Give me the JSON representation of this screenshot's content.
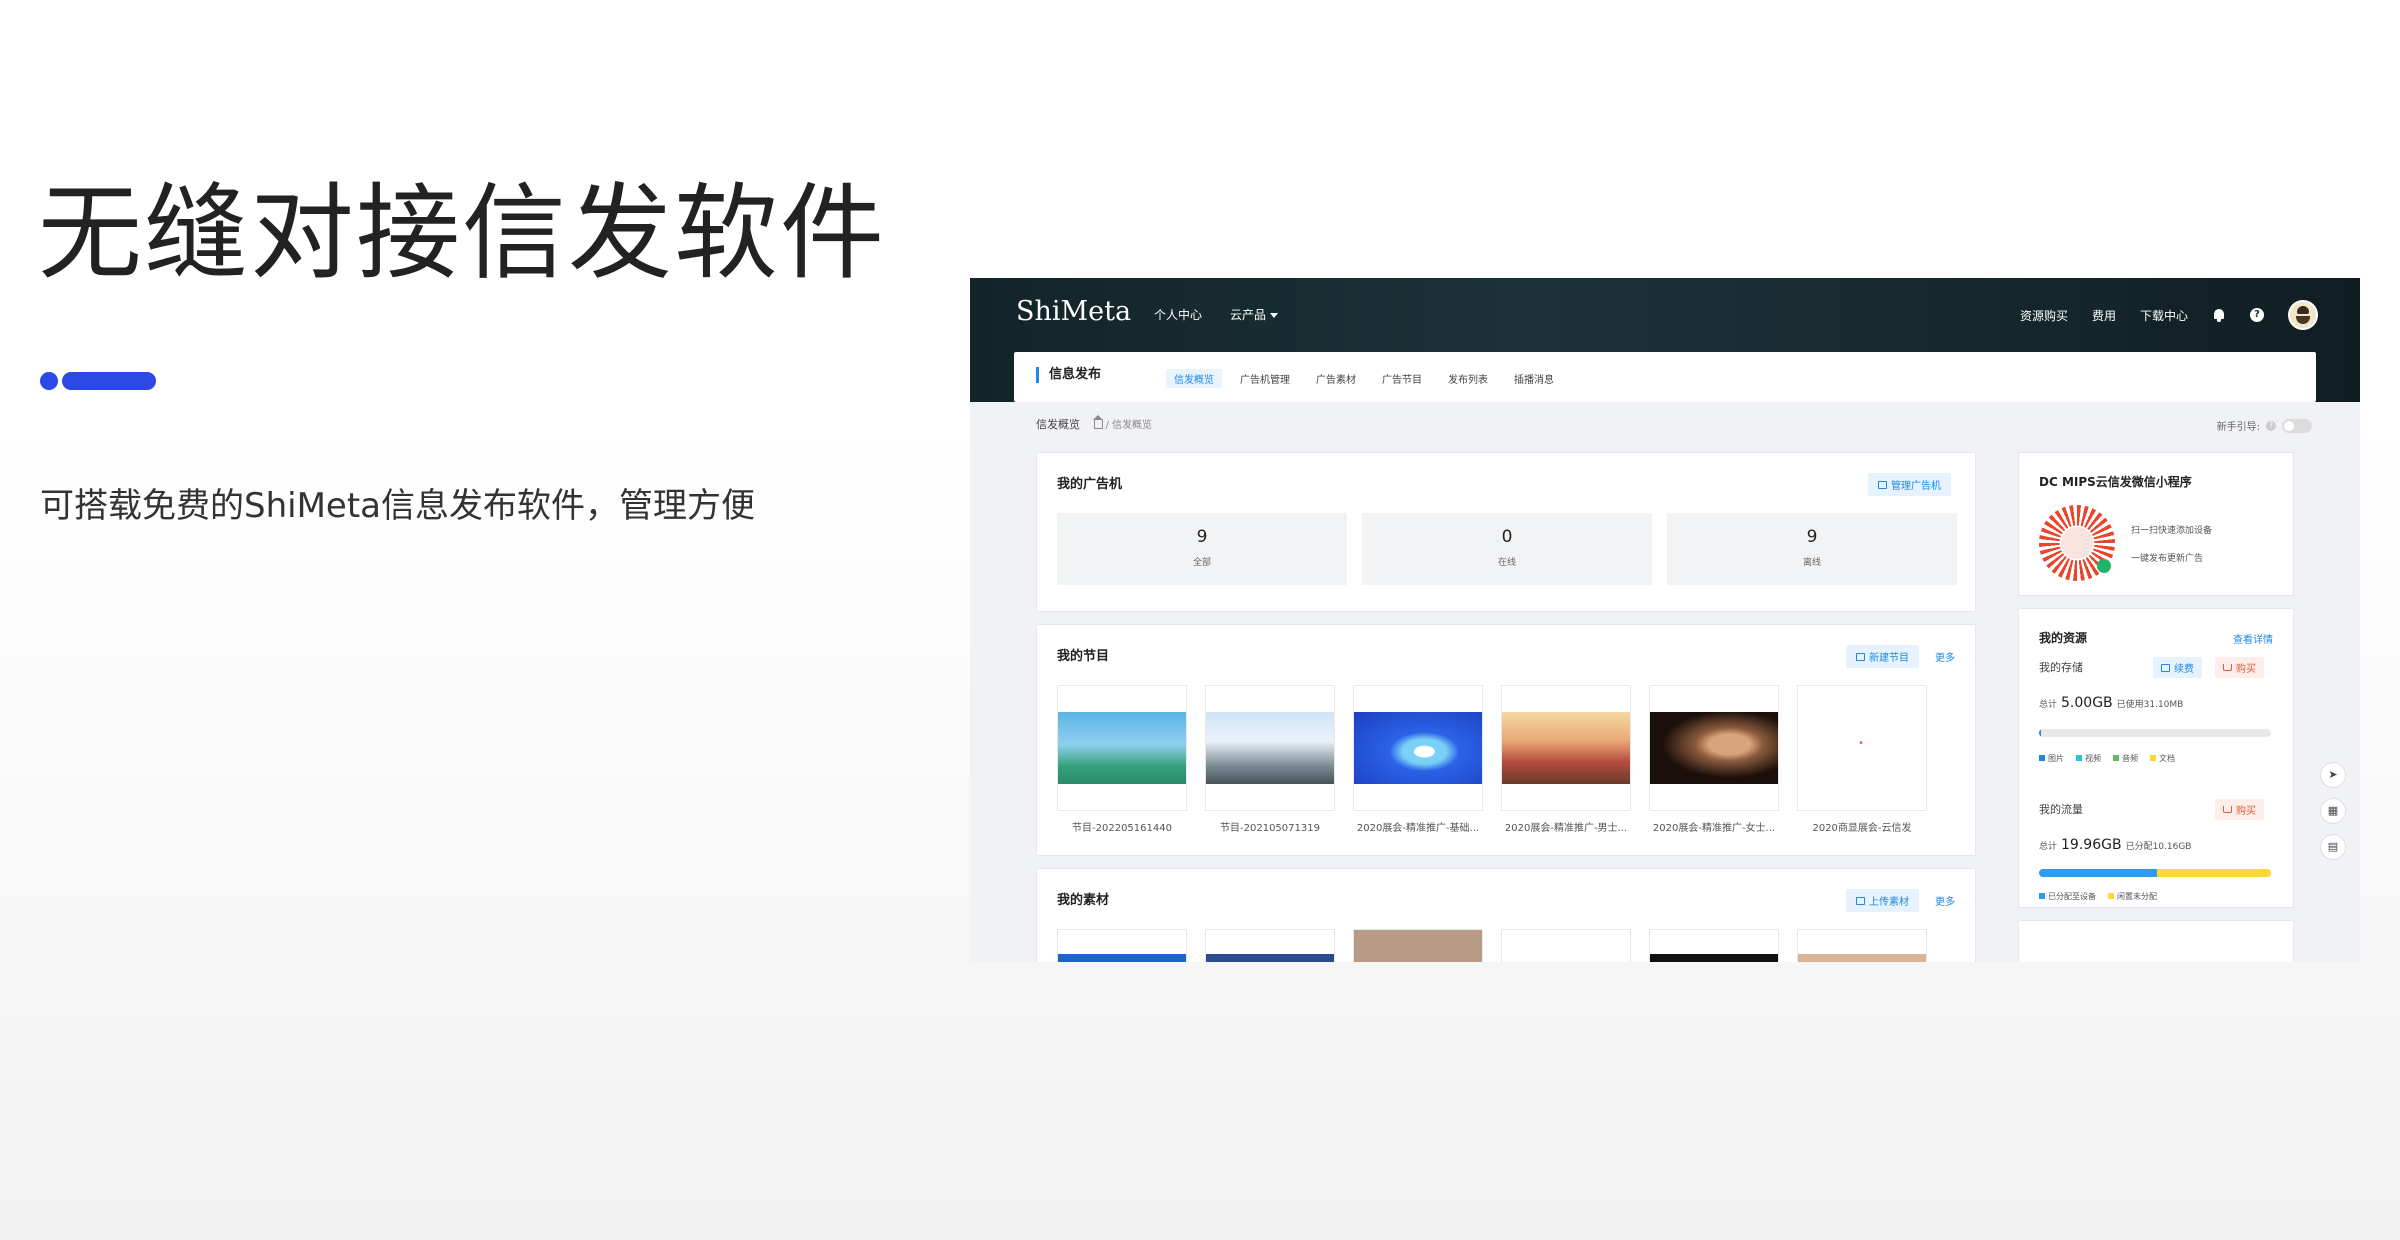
{
  "hero": {
    "title": "无缝对接信发软件",
    "subtitle": "可搭载免费的ShiMeta信息发布软件，管理方便",
    "accent_color": "#2c49e4"
  },
  "app": {
    "brand": "ShiMeta",
    "topnav": [
      "个人中心",
      "云产品"
    ],
    "topright": [
      "资源购买",
      "费用",
      "下载中心"
    ],
    "module_title": "信息发布",
    "tabs": [
      "信发概览",
      "广告机管理",
      "广告素材",
      "广告节目",
      "发布列表",
      "插播消息"
    ],
    "active_tab": "信发概览",
    "breadcrumb_title": "信发概览",
    "breadcrumb_path": "/ 信发概览",
    "guide_label": "新手引导:",
    "ad_machines": {
      "title": "我的广告机",
      "manage_btn": "管理广告机",
      "stats": [
        {
          "value": "9",
          "label": "全部"
        },
        {
          "value": "0",
          "label": "在线"
        },
        {
          "value": "9",
          "label": "离线"
        }
      ]
    },
    "programs": {
      "title": "我的节目",
      "new_btn": "新建节目",
      "more": "更多",
      "items": [
        {
          "caption": "节目-202205161440",
          "image": "beach-palm"
        },
        {
          "caption": "节目-202105071319",
          "image": "car-sky"
        },
        {
          "caption": "2020展会-精准推广-基础...",
          "image": "blue-tech"
        },
        {
          "caption": "2020展会-精准推广-男士...",
          "image": "sports-car"
        },
        {
          "caption": "2020展会-精准推广-女士...",
          "image": "portrait"
        },
        {
          "caption": "2020商显展会-云信发",
          "image": "blank"
        }
      ]
    },
    "materials": {
      "title": "我的素材",
      "upload_btn": "上传素材",
      "more": "更多"
    },
    "miniapp": {
      "title": "DC MIPS云信发微信小程序",
      "line1": "扫一扫快速添加设备",
      "line2": "一键发布更新广告"
    },
    "resources": {
      "title": "我的资源",
      "detail": "查看详情",
      "storage_label": "我的存储",
      "renew_btn": "续费",
      "buy_btn": "购买",
      "storage_total_prefix": "总计",
      "storage_total": "5.00GB",
      "storage_used": "已使用31.10MB",
      "storage_used_fraction": 0.006,
      "storage_legend": [
        "图片",
        "视频",
        "音频",
        "文档"
      ],
      "traffic_label": "我的流量",
      "traffic_buy_btn": "购买",
      "traffic_total_prefix": "总计",
      "traffic_total": "19.96GB",
      "traffic_allocated": "已分配10.16GB",
      "traffic_allocated_fraction": 0.51,
      "traffic_legend": [
        "已分配至设备",
        "闲置未分配"
      ]
    },
    "colors": {
      "primary": "#1e88e5",
      "storage_image": "#1e88e5",
      "storage_video": "#26c6da",
      "storage_audio": "#66bb6a",
      "storage_doc": "#fdd835",
      "traffic_allocated": "#2d9cf0",
      "traffic_idle": "#fdd835"
    }
  }
}
